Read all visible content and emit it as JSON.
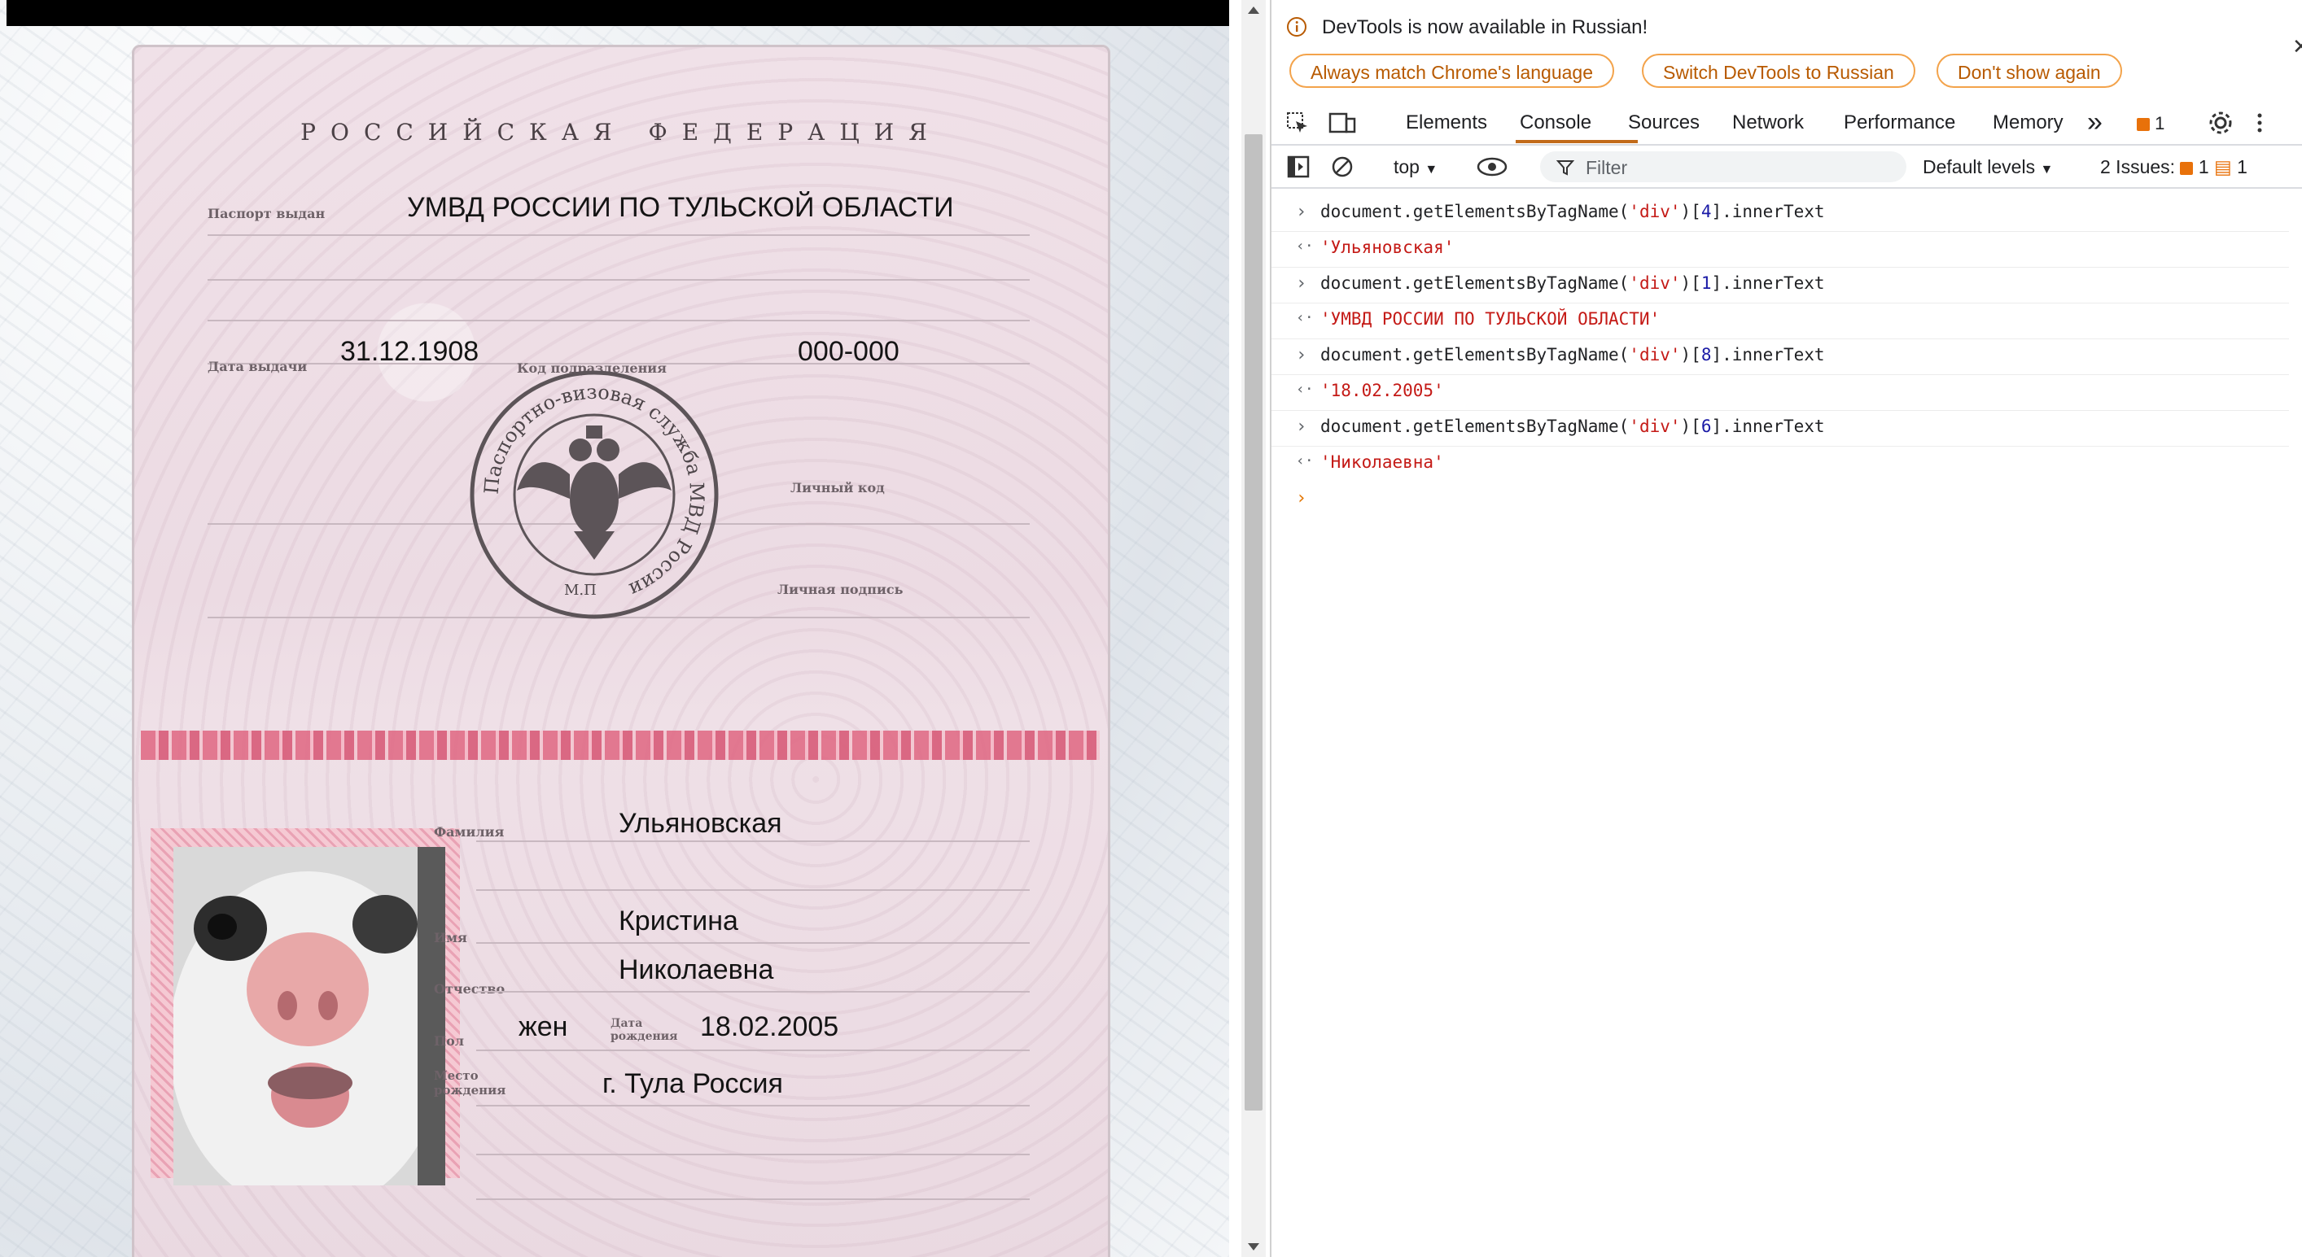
{
  "passport": {
    "header": "РОССИЙСКАЯ ФЕДЕРАЦИЯ",
    "label_issued_by": "Паспорт выдан",
    "issued_by": "УМВД РОССИИ ПО ТУЛЬСКОЙ ОБЛАСТИ",
    "label_issue_date": "Дата выдачи",
    "issue_date": "31.12.1908",
    "label_division_code": "Код подразделения",
    "division_code": "000-000",
    "label_personal_code": "Личный код",
    "label_signature": "Личная подпись",
    "seal_text": "Паспортно-визовая служба МВД России",
    "seal_mp": "М.П",
    "label_surname": "Фамилия",
    "surname": "Ульяновская",
    "label_name": "Имя",
    "name": "Кристина",
    "label_patronymic": "Отчество",
    "patronymic": "Николаевна",
    "label_sex": "Пол",
    "sex": "жен",
    "label_birth_date": "Дата рождения",
    "birth_date": "18.02.2005",
    "label_birth_place": "Место рождения",
    "birth_place": "г. Тула Россия"
  },
  "devtools": {
    "notice": {
      "text": "DevTools is now available in Russian!",
      "btn_match": "Always match Chrome's language",
      "btn_switch": "Switch DevTools to Russian",
      "btn_dont_show": "Don't show again",
      "close": "✕"
    },
    "tabs": [
      "Elements",
      "Console",
      "Sources",
      "Network",
      "Performance",
      "Memory"
    ],
    "tab_more": "»",
    "issues_badge_count": "1",
    "toolbar": {
      "context": "top",
      "filter_placeholder": "Filter",
      "levels": "Default levels",
      "issues_label": "2 Issues:",
      "issues_warn_count": "1",
      "issues_info_count": "1"
    },
    "console": [
      {
        "cmd_prefix": "document.getElementsByTagName(",
        "cmd_arg": "'div'",
        "cmd_mid": ")[",
        "cmd_idx": "4",
        "cmd_suffix": "].innerText",
        "result": "'Ульяновская'"
      },
      {
        "cmd_prefix": "document.getElementsByTagName(",
        "cmd_arg": "'div'",
        "cmd_mid": ")[",
        "cmd_idx": "1",
        "cmd_suffix": "].innerText",
        "result": "'УМВД РОССИИ ПО ТУЛЬСКОЙ ОБЛАСТИ'"
      },
      {
        "cmd_prefix": "document.getElementsByTagName(",
        "cmd_arg": "'div'",
        "cmd_mid": ")[",
        "cmd_idx": "8",
        "cmd_suffix": "].innerText",
        "result": "'18.02.2005'"
      },
      {
        "cmd_prefix": "document.getElementsByTagName(",
        "cmd_arg": "'div'",
        "cmd_mid": ")[",
        "cmd_idx": "6",
        "cmd_suffix": "].innerText",
        "result": "'Николаевна'"
      }
    ],
    "prompt_symbol": "›",
    "output_symbol": "‹·",
    "caret": "›"
  },
  "colors": {
    "accent_orange": "#c26b1a",
    "console_string": "#c41a16",
    "console_number": "#1a1aa6"
  }
}
